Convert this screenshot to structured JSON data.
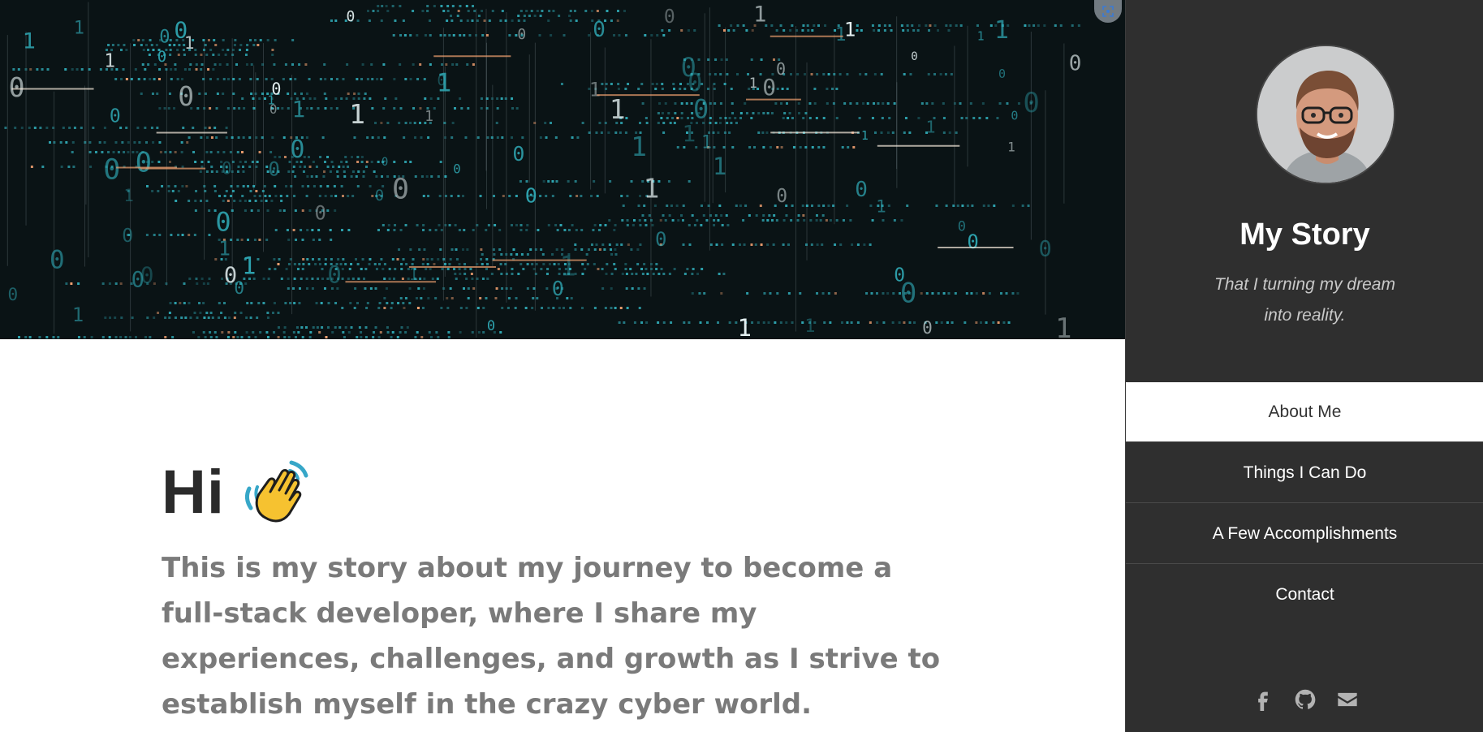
{
  "hero": {
    "accent_color": "#2fa7b3",
    "highlight_color": "#f0a070",
    "tool_icon": "focus-icon"
  },
  "main": {
    "greeting": "Hi",
    "greeting_icon": "waving-hand-icon",
    "intro": "This is my story about my journey to become a full-stack developer, where I share my experiences, challenges, and growth as I strive to establish myself in the crazy cyber world."
  },
  "sidebar": {
    "title": "My Story",
    "tagline": "That I turning my dream into reality.",
    "nav": [
      {
        "label": "About Me",
        "active": true
      },
      {
        "label": "Things I Can Do",
        "active": false
      },
      {
        "label": "A Few Accomplishments",
        "active": false
      },
      {
        "label": "Contact",
        "active": false
      }
    ],
    "social": [
      "facebook-icon",
      "github-icon",
      "email-icon"
    ],
    "background_color": "#2f2f2f"
  }
}
